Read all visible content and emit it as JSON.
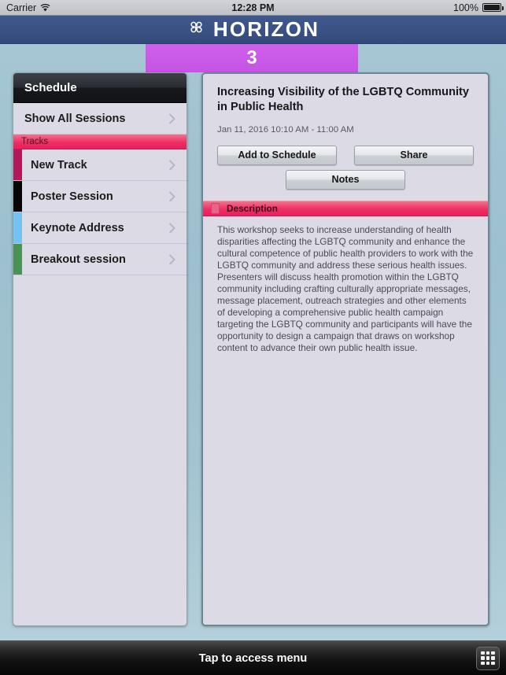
{
  "status_bar": {
    "carrier": "Carrier",
    "wifi_icon": "wifi-icon",
    "time": "12:28 PM",
    "battery_percent": "100%",
    "battery_icon": "battery-full-icon"
  },
  "app_header": {
    "logo_icon": "clover-command-icon",
    "title": "HORIZON"
  },
  "banner": {
    "number": "3",
    "color": "#cc5de8"
  },
  "sidebar": {
    "header": "Schedule",
    "show_all": {
      "label": "Show All Sessions",
      "chevron_icon": "chevron-right-icon"
    },
    "group_header": "Tracks",
    "tracks": [
      {
        "label": "New Track",
        "color": "#b5175c",
        "chevron_icon": "chevron-right-icon"
      },
      {
        "label": "Poster Session",
        "color": "#050505",
        "chevron_icon": "chevron-right-icon"
      },
      {
        "label": "Keynote Address",
        "color": "#74c2f0",
        "chevron_icon": "chevron-right-icon"
      },
      {
        "label": "Breakout session",
        "color": "#4a9253",
        "chevron_icon": "chevron-right-icon"
      }
    ]
  },
  "detail": {
    "title": "Increasing Visibility of the LGBTQ Community in Public Health",
    "datetime": "Jan 11, 2016 10:10 AM - 11:00 AM",
    "buttons": {
      "add": "Add to Schedule",
      "share": "Share",
      "notes": "Notes"
    },
    "description_section": {
      "icon": "document-icon",
      "header": "Description",
      "body": "This workshop seeks to increase understanding of health disparities affecting the LGBTQ community and enhance the cultural competence of public health providers to work with the LGBTQ community and address these serious health issues. Presenters will discuss health promotion within the LGBTQ community including crafting culturally appropriate messages, message placement, outreach strategies and other elements of developing a comprehensive public health campaign targeting the LGBTQ community and participants will have the opportunity to design a campaign that draws on workshop content to advance their own public health issue."
    },
    "accent_color": "#ef2f63"
  },
  "bottom_bar": {
    "label": "Tap to access menu",
    "grid_icon": "grid-menu-icon"
  }
}
